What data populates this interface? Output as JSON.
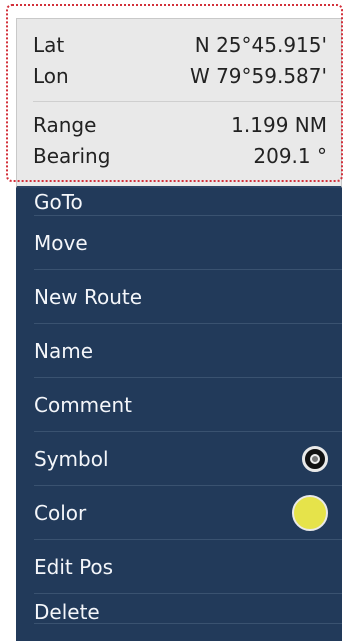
{
  "info": {
    "lat_label": "Lat",
    "lat_value": "N 25°45.915'",
    "lon_label": "Lon",
    "lon_value": "W 79°59.587'",
    "range_label": "Range",
    "range_value": "1.199 NM",
    "bearing_label": "Bearing",
    "bearing_value": "209.1 °"
  },
  "menu": {
    "items": [
      {
        "label": "GoTo"
      },
      {
        "label": "Move"
      },
      {
        "label": "New Route"
      },
      {
        "label": "Name"
      },
      {
        "label": "Comment"
      },
      {
        "label": "Symbol",
        "icon": "bullseye-symbol-icon"
      },
      {
        "label": "Color",
        "swatch": "#e6e34a"
      },
      {
        "label": "Edit Pos"
      },
      {
        "label": "Delete"
      }
    ]
  }
}
